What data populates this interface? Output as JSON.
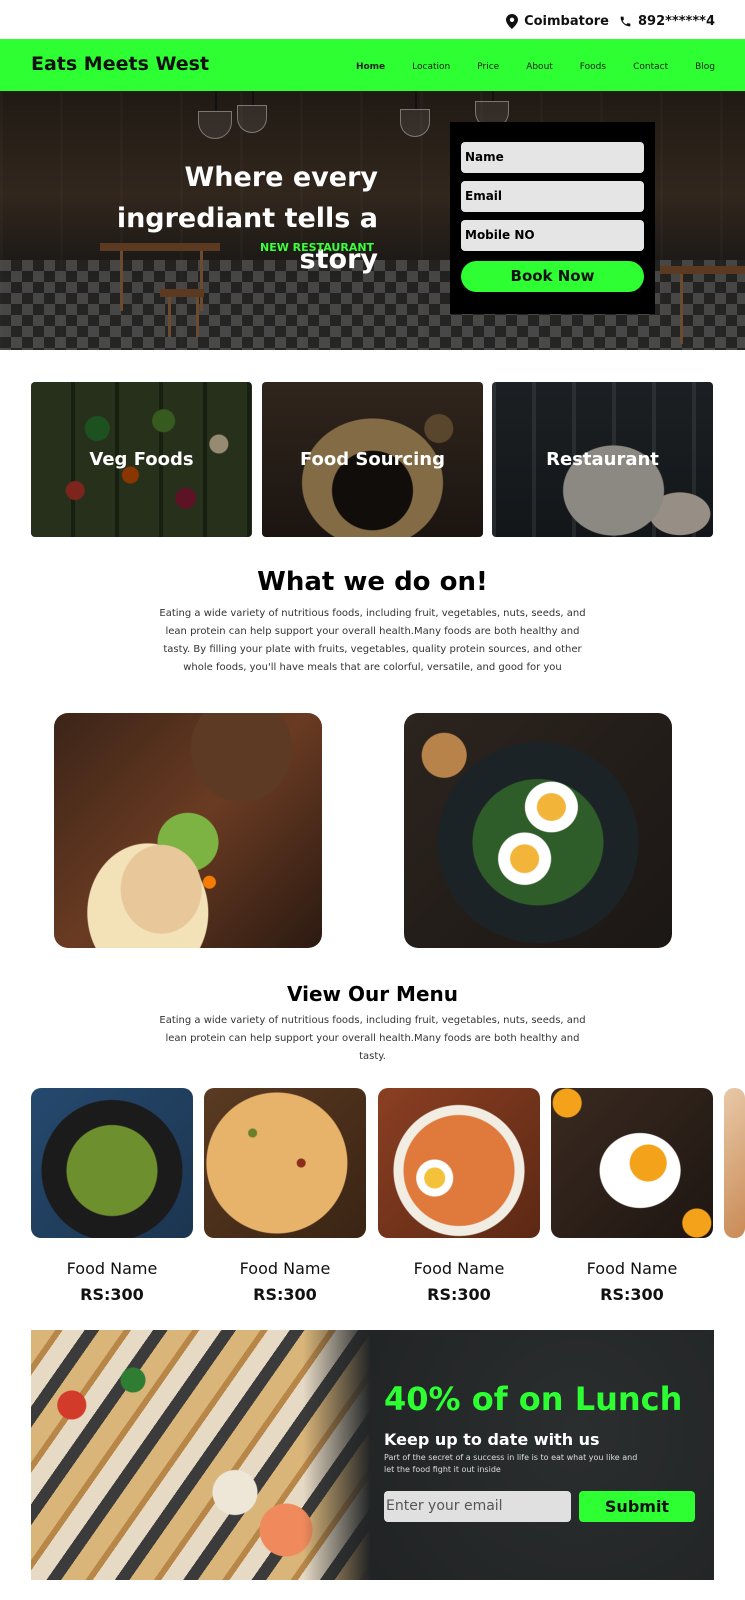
{
  "topbar": {
    "location": "Coimbatore",
    "phone": "892******4",
    "location_icon": "map-pin-icon",
    "phone_icon": "phone-icon"
  },
  "nav": {
    "brand": "Eats Meets West",
    "items": [
      "Home",
      "Location",
      "Price",
      "About",
      "Foods",
      "Contact",
      "Blog"
    ],
    "active": "Home"
  },
  "hero": {
    "heading_line1": "Where every",
    "heading_line2": "ingrediant tells a story",
    "tag": "NEW RESTAURANT",
    "form": {
      "name": "Name",
      "email": "Email",
      "mobile": "Mobile NO",
      "button": "Book Now"
    }
  },
  "categories": [
    "Veg Foods",
    "Food Sourcing",
    "Restaurant"
  ],
  "about": {
    "title": "What we do on!",
    "text": "Eating a wide variety of nutritious foods, including fruit, vegetables, nuts, seeds, and lean protein can help support your overall health.Many foods are both healthy and tasty. By filling your plate with fruits, vegetables, quality protein sources, and other whole foods, you'll have meals that are colorful, versatile, and good for you"
  },
  "menu": {
    "title": "View Our Menu",
    "text": "Eating a wide variety of nutritious foods, including fruit, vegetables, nuts, seeds, and lean protein can help support your overall health.Many foods are both healthy and tasty.",
    "items": [
      {
        "name": "Food Name",
        "price": "RS:300"
      },
      {
        "name": "Food Name",
        "price": "RS:300"
      },
      {
        "name": "Food Name",
        "price": "RS:300"
      },
      {
        "name": "Food Name",
        "price": "RS:300"
      }
    ]
  },
  "promo": {
    "headline": "40% of on Lunch",
    "subheadline": "Keep up to date with us",
    "text": "Part of the secret of a success in life is to eat what you like and let the food fight it out inside",
    "email_placeholder": "Enter your email",
    "button": "Submit"
  },
  "colors": {
    "accent": "#2dff33",
    "dark": "#000000"
  }
}
